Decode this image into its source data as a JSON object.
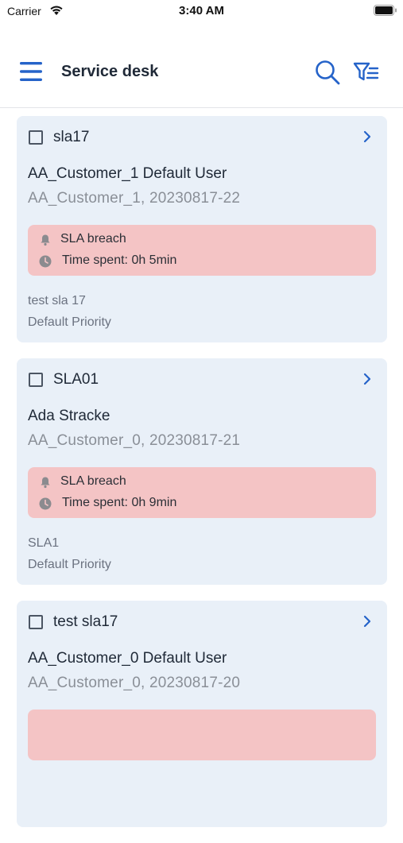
{
  "status_bar": {
    "carrier": "Carrier",
    "time": "3:40 AM"
  },
  "header": {
    "title": "Service desk",
    "menu_icon": "hamburger-menu-icon",
    "search_icon": "search-icon",
    "filter_icon": "filter-list-icon"
  },
  "colors": {
    "accent": "#2563c9",
    "card_bg": "#e9f0f8",
    "sla_bg": "#f4c4c5",
    "muted_text": "#8a8f97"
  },
  "tickets": [
    {
      "id": "sla17",
      "customer_name": "AA_Customer_1 Default User",
      "customer_meta": "AA_Customer_1,  20230817-22",
      "sla_status": "SLA breach",
      "time_spent": "Time spent: 0h 5min",
      "subject": "test sla 17",
      "priority": "Default Priority"
    },
    {
      "id": "SLA01",
      "customer_name": "Ada Stracke",
      "customer_meta": "AA_Customer_0,  20230817-21",
      "sla_status": "SLA breach",
      "time_spent": "Time spent: 0h 9min",
      "subject": "SLA1",
      "priority": "Default Priority"
    },
    {
      "id": "test sla17",
      "customer_name": "AA_Customer_0 Default User",
      "customer_meta": "AA_Customer_0,  20230817-20",
      "sla_status": "",
      "time_spent": "",
      "subject": "",
      "priority": ""
    }
  ]
}
